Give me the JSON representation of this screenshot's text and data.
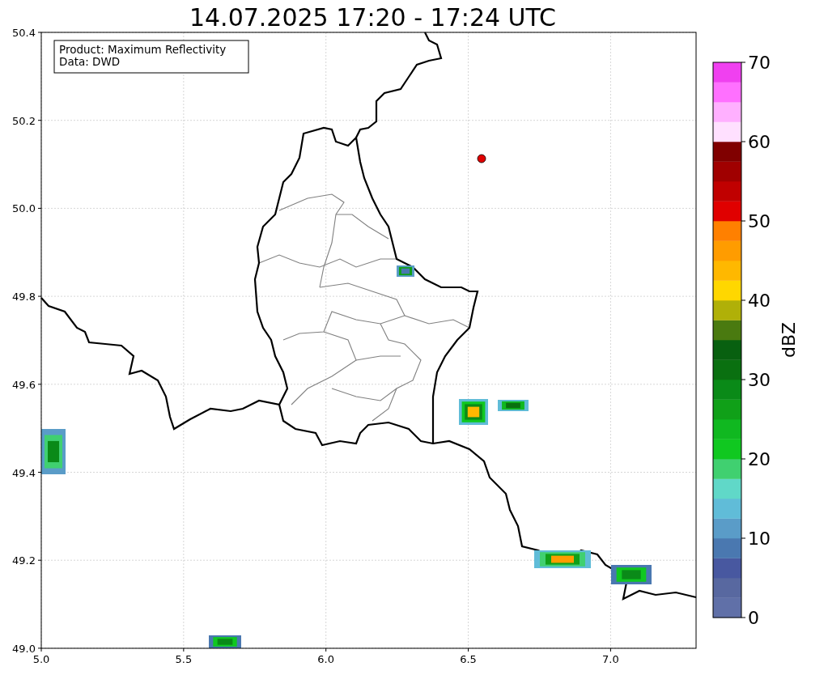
{
  "title": "14.07.2025 17:20 - 17:24 UTC",
  "info_box": {
    "lines": [
      "Product: Maximum Reflectivity",
      "Data: DWD"
    ]
  },
  "map": {
    "xticks": [
      "5.0",
      "5.5",
      "6.0",
      "6.5",
      "7.0"
    ],
    "yticks": [
      "50.4",
      "50.2",
      "50.0",
      "49.8",
      "49.6",
      "49.4",
      "49.2",
      "49.0"
    ]
  },
  "colorbar": {
    "label": "dBZ",
    "ticks": [
      "70",
      "60",
      "50",
      "40",
      "30",
      "20",
      "10",
      "0"
    ],
    "bins": [
      {
        "color": "#6070a8"
      },
      {
        "color": "#5868a0"
      },
      {
        "color": "#4858a0"
      },
      {
        "color": "#4a78b0"
      },
      {
        "color": "#5a9cc8"
      },
      {
        "color": "#60bcd8"
      },
      {
        "color": "#60d8c8"
      },
      {
        "color": "#40d070"
      },
      {
        "color": "#10c820"
      },
      {
        "color": "#10b820"
      },
      {
        "color": "#10a018"
      },
      {
        "color": "#0a8a18"
      },
      {
        "color": "#0a7010"
      },
      {
        "color": "#086010"
      },
      {
        "color": "#4a7a10"
      },
      {
        "color": "#b0b008"
      },
      {
        "color": "#ffd700"
      },
      {
        "color": "#ffb800"
      },
      {
        "color": "#ff9c00"
      },
      {
        "color": "#ff8000"
      },
      {
        "color": "#e00000"
      },
      {
        "color": "#c00000"
      },
      {
        "color": "#a00000"
      },
      {
        "color": "#800000"
      },
      {
        "color": "#ffe0ff"
      },
      {
        "color": "#ffb0ff"
      },
      {
        "color": "#ff70ff"
      },
      {
        "color": "#f040f0"
      }
    ]
  }
}
